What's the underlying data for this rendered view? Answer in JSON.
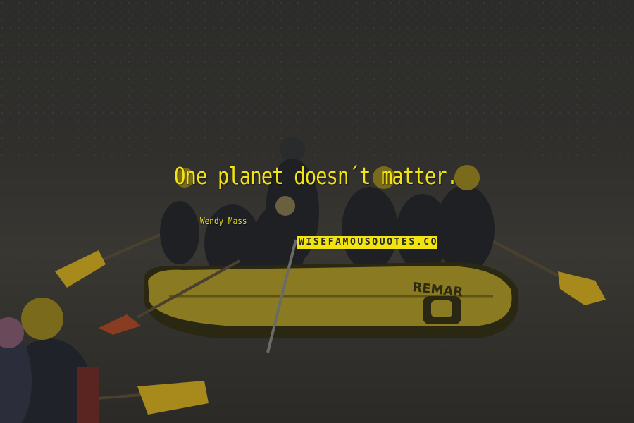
{
  "quote": {
    "text": "One planet doesn´t matter.",
    "author": "Wendy Mass"
  },
  "watermark": {
    "text": "WISEFAMOUSQUOTES.COM"
  },
  "raft": {
    "brand": "REMAR"
  },
  "colors": {
    "accent_yellow": "#f2e313",
    "background_dark": "#2a2a27",
    "water": "#3a3934",
    "raft_yellow": "#8a7a22",
    "paddle_yellow": "#a8891c",
    "paddle_red": "#8a3c22"
  }
}
